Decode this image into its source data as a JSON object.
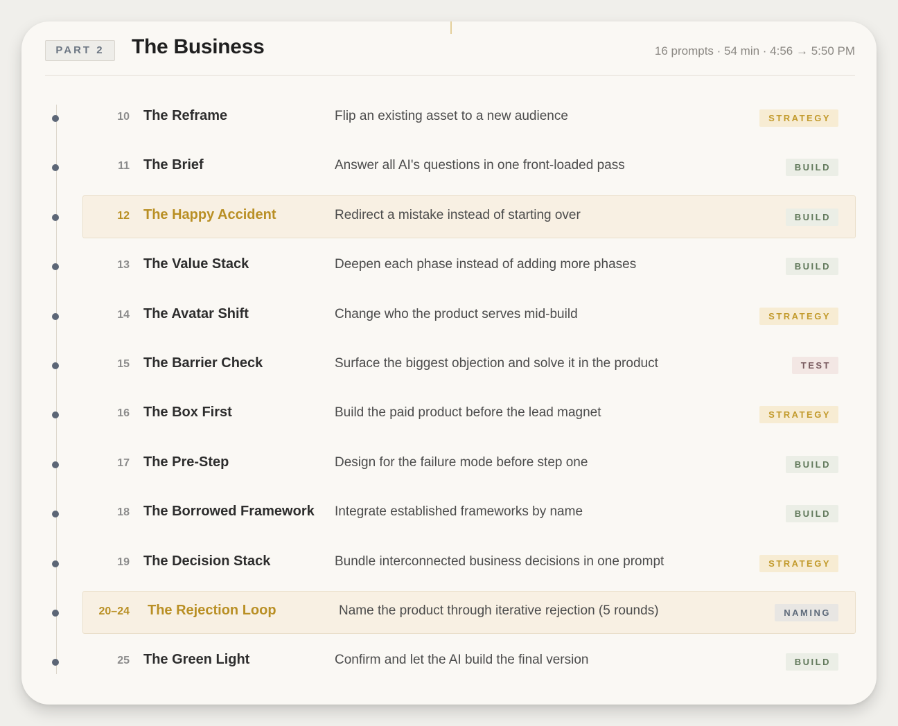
{
  "header": {
    "part_label": "PART 2",
    "title": "The Business",
    "meta": "16 prompts · 54 min · 4:56 → 5:50 PM"
  },
  "colors": {
    "highlight_bg": "#f8f0e3",
    "highlight_text": "#b98f24",
    "timeline_dot": "#5c6676",
    "strategy": "#c29a2c",
    "build": "#61795b",
    "test": "#7a5c60",
    "naming": "#5f6b7b"
  },
  "rows": [
    {
      "num": "10",
      "name": "The Reframe",
      "desc": "Flip an existing asset to a new audience",
      "tag": "STRATEGY",
      "highlighted": false
    },
    {
      "num": "11",
      "name": "The Brief",
      "desc": "Answer all AI's questions in one front-loaded pass",
      "tag": "BUILD",
      "highlighted": false
    },
    {
      "num": "12",
      "name": "The Happy Accident",
      "desc": "Redirect a mistake instead of starting over",
      "tag": "BUILD",
      "highlighted": true
    },
    {
      "num": "13",
      "name": "The Value Stack",
      "desc": "Deepen each phase instead of adding more phases",
      "tag": "BUILD",
      "highlighted": false
    },
    {
      "num": "14",
      "name": "The Avatar Shift",
      "desc": "Change who the product serves mid-build",
      "tag": "STRATEGY",
      "highlighted": false
    },
    {
      "num": "15",
      "name": "The Barrier Check",
      "desc": "Surface the biggest objection and solve it in the product",
      "tag": "TEST",
      "highlighted": false
    },
    {
      "num": "16",
      "name": "The Box First",
      "desc": "Build the paid product before the lead magnet",
      "tag": "STRATEGY",
      "highlighted": false
    },
    {
      "num": "17",
      "name": "The Pre-Step",
      "desc": "Design for the failure mode before step one",
      "tag": "BUILD",
      "highlighted": false
    },
    {
      "num": "18",
      "name": "The Borrowed Framework",
      "desc": "Integrate established frameworks by name",
      "tag": "BUILD",
      "highlighted": false
    },
    {
      "num": "19",
      "name": "The Decision Stack",
      "desc": "Bundle interconnected business decisions in one prompt",
      "tag": "STRATEGY",
      "highlighted": false
    },
    {
      "num": "20–24",
      "name": "The Rejection Loop",
      "desc": "Name the product through iterative rejection (5 rounds)",
      "tag": "NAMING",
      "highlighted": true
    },
    {
      "num": "25",
      "name": "The Green Light",
      "desc": "Confirm and let the AI build the final version",
      "tag": "BUILD",
      "highlighted": false
    }
  ]
}
